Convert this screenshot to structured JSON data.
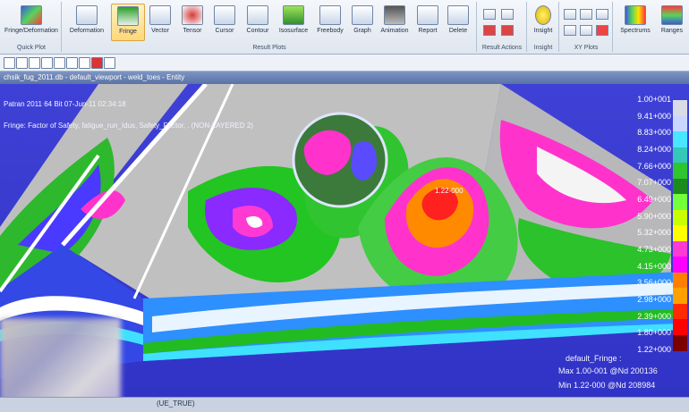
{
  "ribbon": {
    "quick_plot": {
      "label": "Quick Plot",
      "buttons": [
        "Fringe/Deformation"
      ]
    },
    "result_plots": {
      "label": "Result Plots",
      "buttons": [
        "Deformation",
        "Fringe",
        "Vector",
        "Tensor",
        "Cursor",
        "Contour",
        "Isosurface",
        "Freebody",
        "Graph",
        "Animation",
        "Report",
        "Delete"
      ]
    },
    "result_actions": {
      "label": "Result Actions"
    },
    "insight": {
      "label": "Insight",
      "buttons": [
        "Insight"
      ]
    },
    "xy_plots": {
      "label": "XY Plots"
    },
    "extra": {
      "buttons": [
        "Spectrums",
        "Ranges"
      ]
    }
  },
  "viewport": {
    "title": "chsik_fug_2011.db - default_viewport - weld_toes - Entity",
    "line1": "Patran 2011 64 Bit 07-Jun-11 02:34:18",
    "line2": "Fringe: Factor of Safety, fatigue_run_Idus, Safety_Factor, . (NON-LAYERED 2)",
    "probe": "1.22-000",
    "footer_left": "(UE_TRUE)"
  },
  "legend": {
    "labels": [
      "1.00+001",
      "9.41+000",
      "8.83+000",
      "8.24+000",
      "7.66+000",
      "7.07+000",
      "6.49+000",
      "5.90+000",
      "5.32+000",
      "4.73+000",
      "4.15+000",
      "3.56+000",
      "2.98+000",
      "2.39+000",
      "1.80+000",
      "1.22+000"
    ],
    "colors": [
      "#d9dbe6",
      "#c8d7ff",
      "#48e7ff",
      "#33c8b8",
      "#2ec52e",
      "#1b8c1b",
      "#73ff3a",
      "#c8ff00",
      "#ffff00",
      "#ff3ad2",
      "#ff00ff",
      "#ff8000",
      "#ffa000",
      "#ff2a00",
      "#ff0000",
      "#7a0000"
    ],
    "title": "default_Fringe :",
    "max": "Max 1.00-001 @Nd 200136",
    "min": "Min 1.22-000 @Nd 208984"
  },
  "colors": {
    "viewport_bg": "#3436cb",
    "accent": "#d9a640"
  }
}
